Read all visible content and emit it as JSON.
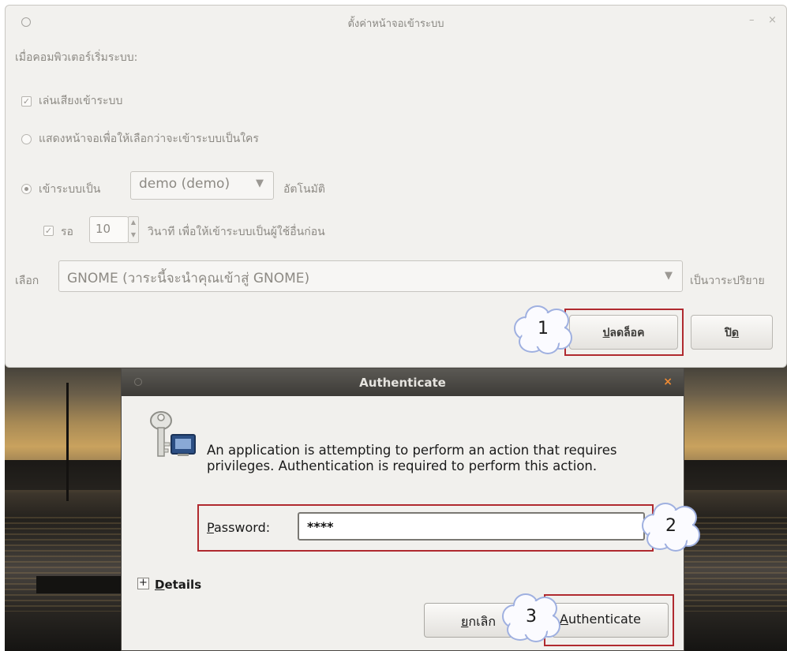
{
  "main_window": {
    "title": "ตั้งค่าหน้าจอเข้าระบบ",
    "minimize_glyph": "–",
    "close_glyph": "×",
    "section_label": "เมื่อคอมพิวเตอร์เริ่มระบบ:",
    "play_sound_label": "เล่นเสียงเข้าระบบ",
    "play_sound_checked": true,
    "show_screen_label": "แสดงหน้าจอเพื่อให้เลือกว่าจะเข้าระบบเป็นใคร",
    "login_as_label": "เข้าระบบเป็น",
    "login_as_value": "demo (demo)",
    "auto_label": "อัตโนมัติ",
    "wait_label": "รอ",
    "wait_value": "10",
    "wait_suffix": "วินาที เพื่อให้เข้าระบบเป็นผู้ใช้อื่นก่อน",
    "select_label": "เลือก",
    "session_value": "GNOME (วาระนี้จะนำคุณเข้าสู่ GNOME)",
    "default_label": "เป็นวาระปริยาย",
    "unlock_button_prefix": "ป",
    "unlock_button_rest": "ลดล็อค",
    "close_button_prefix": "ปิ",
    "close_button_underlined": "ด",
    "dropdown_glyph": "▼",
    "spin_up_glyph": "▲",
    "spin_down_glyph": "▼"
  },
  "auth_dialog": {
    "title": "Authenticate",
    "close_glyph": "×",
    "message": "An application is attempting to perform an action that requires privileges. Authentication is required to perform this action.",
    "password_label_first": "P",
    "password_label_rest": "assword:",
    "password_value": "****",
    "details_toggle": "+",
    "details_label_first": "D",
    "details_label_rest": "etails",
    "cancel_label_first": "ย",
    "cancel_label_rest": "กเลิก",
    "authenticate_label_first": "A",
    "authenticate_label_rest": "uthenticate"
  },
  "annotations": {
    "step1": "1",
    "step2": "2",
    "step3": "3",
    "highlight_color": "#b02a2f"
  },
  "colors": {
    "window_bg": "#f2f1ee",
    "auth_titlebar": "#3d3b37",
    "close_orange": "#ef8b33"
  }
}
